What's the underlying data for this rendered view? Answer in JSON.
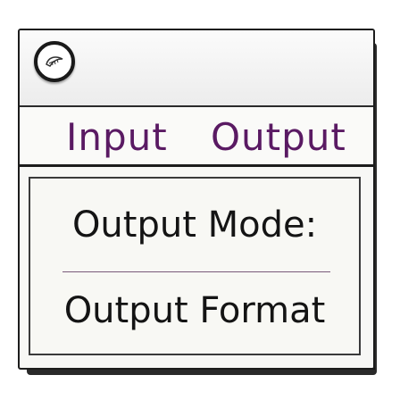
{
  "window": {
    "logo_icon": "feather-logo-icon"
  },
  "tabs": [
    {
      "label": "Input"
    },
    {
      "label": "Output"
    }
  ],
  "menu": {
    "items": [
      {
        "label": "Output Mode:"
      },
      {
        "label": "Output Format"
      }
    ]
  },
  "colors": {
    "tab_text": "#5a1a63",
    "menu_text": "#141414",
    "border": "#1c1c1c"
  }
}
